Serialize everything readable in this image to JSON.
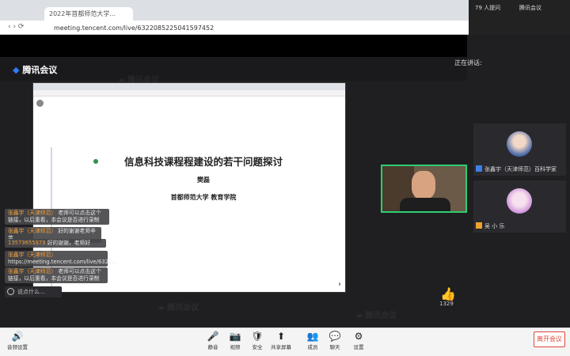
{
  "browser": {
    "tab_title": "2022年首都师范大学...",
    "url": "meeting.tencent.com/live/6322085225041597452",
    "tray_text": "79 人提问",
    "tray_text2": "腾讯会议"
  },
  "app": {
    "logo": "腾讯会议",
    "panel_top_label": "正在讲话:"
  },
  "slide": {
    "title": "信息科技课程程建设的若干问题探讨",
    "author": "樊磊",
    "institution": "首都师范大学 教育学院"
  },
  "participants": [
    {
      "name": "张鑫宇（天津师范）百科学家",
      "badge_color": "#3f7ee8"
    },
    {
      "name": "吴 小 乐",
      "badge_color": "#f0a030"
    }
  ],
  "chat": [
    {
      "name": "张鑫宇（天津师范）",
      "text": "老师可以点击这个链接，以后重看，本会议是否进行录制"
    },
    {
      "name": "张鑫宇（天津师范）",
      "text": "好的谢谢老师辛苦"
    },
    {
      "name": "13573655979",
      "text": "好的谢谢，老师好"
    },
    {
      "name": "张鑫宇（天津师范）",
      "text": "https://meeting.tencent.com/live/6322..."
    },
    {
      "name": "张鑫宇（天津师范）",
      "text": "老师可以点击这个链接，以后重看，本会议是否进行录制"
    }
  ],
  "chat_input_placeholder": "说点什么...",
  "like_count": "1329",
  "like_icon": "thumbs-up-icon",
  "toolbar": {
    "audio": "音频设置",
    "items": [
      {
        "label": "静音",
        "icon": "mic-icon"
      },
      {
        "label": "视频",
        "icon": "camera-icon"
      },
      {
        "label": "安全",
        "icon": "shield-icon"
      },
      {
        "label": "共享屏幕",
        "icon": "share-icon"
      },
      {
        "label": "成员",
        "icon": "members-icon"
      },
      {
        "label": "聊天",
        "icon": "chat-icon"
      },
      {
        "label": "设置",
        "icon": "gear-icon"
      }
    ],
    "leave": "离开会议"
  }
}
